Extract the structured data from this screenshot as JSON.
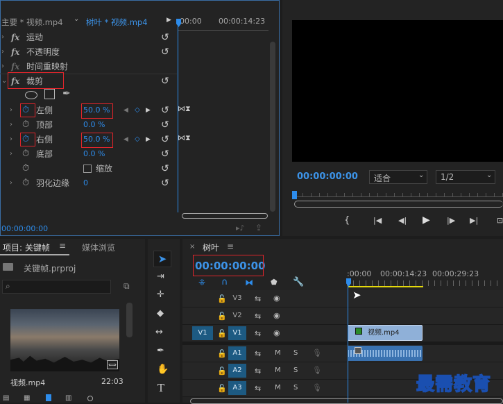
{
  "effect_controls": {
    "source_tab": "主要 * 视频.mp4",
    "clip_tab": "树叶 * 视频.mp4",
    "timecode_start": "00:00",
    "timecode_end": "00:00:14:23",
    "fx_items": [
      {
        "label": "运动"
      },
      {
        "label": "不透明度"
      },
      {
        "label": "时间重映射"
      },
      {
        "label": "裁剪"
      }
    ],
    "params": [
      {
        "label": "左侧",
        "value": "50.0 %"
      },
      {
        "label": "顶部",
        "value": "0.0 %"
      },
      {
        "label": "右侧",
        "value": "50.0 %"
      },
      {
        "label": "底部",
        "value": "0.0 %"
      },
      {
        "label": "缩放",
        "value": ""
      },
      {
        "label": "羽化边缘",
        "value": "0"
      }
    ],
    "bottom_timecode": "00:00:00:00"
  },
  "program_monitor": {
    "timecode": "00:00:00:00",
    "fit": "适合",
    "resolution": "1/2"
  },
  "project": {
    "tab_project": "项目: 关键帧",
    "tab_media": "媒体浏览",
    "file_name": "关键帧.prproj",
    "clip_name": "视频.mp4",
    "clip_duration": "22:03"
  },
  "timeline": {
    "sequence": "树叶",
    "timecode": "00:00:00:00",
    "ruler": [
      ":00:00",
      "00:00:14:23",
      "00:00:29:23"
    ],
    "tracks": [
      {
        "name": "V3"
      },
      {
        "name": "V2"
      },
      {
        "name": "V1"
      },
      {
        "name": "A1"
      },
      {
        "name": "A2"
      },
      {
        "name": "A3"
      }
    ],
    "source_patch": "V1",
    "clip_label": "视频.mp4",
    "mute": "M",
    "solo": "S"
  },
  "watermark": "最需教育"
}
